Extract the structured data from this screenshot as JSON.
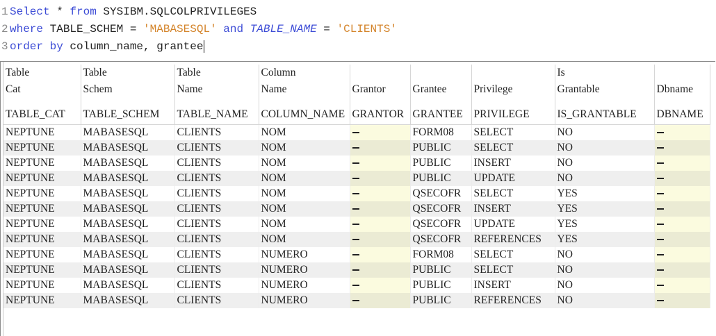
{
  "editor": {
    "lines": [
      {
        "num": "1",
        "kw1": "Select",
        "t1": " * ",
        "kw2": "from",
        "t2": " SYSIBM.SQLCOLPRIVILEGES"
      },
      {
        "num": "2",
        "kw1": "where",
        "t1": " TABLE_SCHEM = ",
        "s1": "'MABASESQL'",
        "kw2": " and ",
        "it1": "TABLE_NAME",
        "t2": " = ",
        "s2": "'CLIENTS'"
      },
      {
        "num": "3",
        "kw1": "order by",
        "t1": " column_name, grantee"
      }
    ]
  },
  "grid": {
    "headers": [
      {
        "label": "Table\nCat",
        "column": "TABLE_CAT"
      },
      {
        "label": "Table\nSchem",
        "column": "TABLE_SCHEM"
      },
      {
        "label": "Table\nName",
        "column": "TABLE_NAME"
      },
      {
        "label": "Column\nName",
        "column": "COLUMN_NAME"
      },
      {
        "label": "\nGrantor",
        "column": "GRANTOR"
      },
      {
        "label": "\nGrantee",
        "column": "GRANTEE"
      },
      {
        "label": "\nPrivilege",
        "column": "PRIVILEGE"
      },
      {
        "label": "Is\nGrantable",
        "column": "IS_GRANTABLE"
      },
      {
        "label": "\nDbname",
        "column": "DBNAME"
      }
    ],
    "rows": [
      [
        "NEPTUNE",
        "MABASESQL",
        "CLIENTS",
        "NOM",
        null,
        "FORM08",
        "SELECT",
        "NO",
        null
      ],
      [
        "NEPTUNE",
        "MABASESQL",
        "CLIENTS",
        "NOM",
        null,
        "PUBLIC",
        "SELECT",
        "NO",
        null
      ],
      [
        "NEPTUNE",
        "MABASESQL",
        "CLIENTS",
        "NOM",
        null,
        "PUBLIC",
        "INSERT",
        "NO",
        null
      ],
      [
        "NEPTUNE",
        "MABASESQL",
        "CLIENTS",
        "NOM",
        null,
        "PUBLIC",
        "UPDATE",
        "NO",
        null
      ],
      [
        "NEPTUNE",
        "MABASESQL",
        "CLIENTS",
        "NOM",
        null,
        "QSECOFR",
        "SELECT",
        "YES",
        null
      ],
      [
        "NEPTUNE",
        "MABASESQL",
        "CLIENTS",
        "NOM",
        null,
        "QSECOFR",
        "INSERT",
        "YES",
        null
      ],
      [
        "NEPTUNE",
        "MABASESQL",
        "CLIENTS",
        "NOM",
        null,
        "QSECOFR",
        "UPDATE",
        "YES",
        null
      ],
      [
        "NEPTUNE",
        "MABASESQL",
        "CLIENTS",
        "NOM",
        null,
        "QSECOFR",
        "REFERENCES",
        "YES",
        null
      ],
      [
        "NEPTUNE",
        "MABASESQL",
        "CLIENTS",
        "NUMERO",
        null,
        "FORM08",
        "SELECT",
        "NO",
        null
      ],
      [
        "NEPTUNE",
        "MABASESQL",
        "CLIENTS",
        "NUMERO",
        null,
        "PUBLIC",
        "SELECT",
        "NO",
        null
      ],
      [
        "NEPTUNE",
        "MABASESQL",
        "CLIENTS",
        "NUMERO",
        null,
        "PUBLIC",
        "INSERT",
        "NO",
        null
      ],
      [
        "NEPTUNE",
        "MABASESQL",
        "CLIENTS",
        "NUMERO",
        null,
        "PUBLIC",
        "REFERENCES",
        "NO",
        null
      ]
    ]
  }
}
